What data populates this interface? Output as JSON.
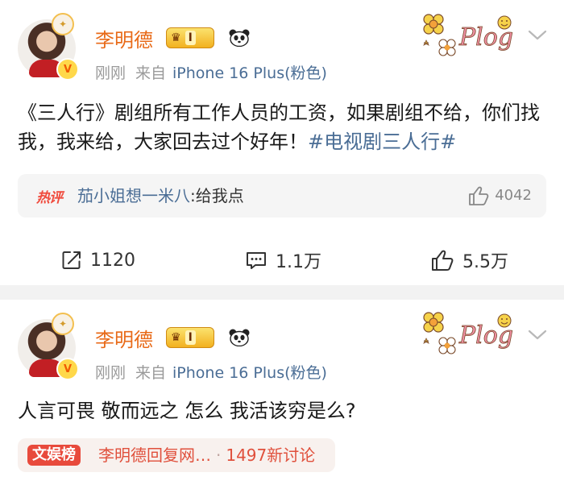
{
  "posts": [
    {
      "author": "李明德",
      "rank": "I",
      "time": "刚刚",
      "source_prefix": "来自",
      "device": "iPhone 16 Plus(粉色)",
      "verified_mark": "V",
      "body_main": "《三人行》剧组所有工作人员的工资，如果剧组不给，你们找我，我来给，大家回去过个好年！",
      "body_tag": "#电视剧三人行#",
      "hot_comment": {
        "badge": "热评",
        "user": "茄小姐想一米八",
        "separator": ":",
        "text": "给我点",
        "likes": "4042"
      },
      "actions": {
        "repost": "1120",
        "comment": "1.1万",
        "like": "5.5万"
      },
      "decoration_icon": "flower-plog-sticker-icon",
      "more_icon": "chevron-down-icon"
    },
    {
      "author": "李明德",
      "rank": "I",
      "time": "刚刚",
      "source_prefix": "来自",
      "device": "iPhone 16 Plus(粉色)",
      "verified_mark": "V",
      "body_main": "人言可畏 敬而远之  怎么 我活该穷是么?",
      "trend": {
        "badge": "文娱榜",
        "title": "李明德回复网…",
        "dot": "·",
        "count": "1497新讨论"
      },
      "decoration_icon": "flower-plog-sticker-icon",
      "more_icon": "chevron-down-icon"
    }
  ],
  "colors": {
    "username": "#e86a18",
    "link": "#4a6d95",
    "meta": "#9a9a9a",
    "hot_badge": "#f04a3c",
    "trend_badge": "#e84a3c",
    "background": "#f2f2f2"
  }
}
